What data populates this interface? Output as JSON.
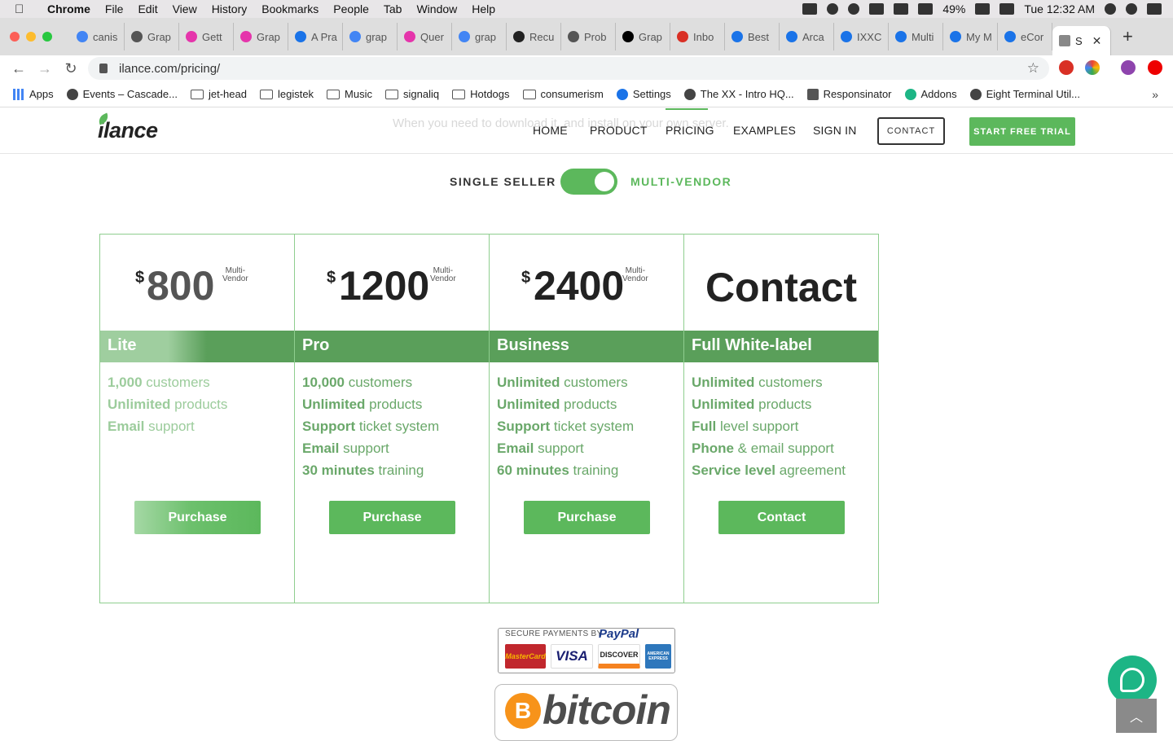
{
  "menubar": {
    "app": "Chrome",
    "items": [
      "File",
      "Edit",
      "View",
      "History",
      "Bookmarks",
      "People",
      "Tab",
      "Window",
      "Help"
    ],
    "battery": "49%",
    "clock": "Tue 12:32 AM"
  },
  "tabs": [
    {
      "label": "canis",
      "color": "#4285f4"
    },
    {
      "label": "Grap",
      "color": "#555555"
    },
    {
      "label": "Gett",
      "color": "#e535ab"
    },
    {
      "label": "Grap",
      "color": "#e535ab"
    },
    {
      "label": "A Pra",
      "color": "#1a73e8"
    },
    {
      "label": "grap",
      "color": "#4285f4"
    },
    {
      "label": "Quer",
      "color": "#e535ab"
    },
    {
      "label": "grap",
      "color": "#4285f4"
    },
    {
      "label": "Recu",
      "color": "#222222"
    },
    {
      "label": "Prob",
      "color": "#555555"
    },
    {
      "label": "Grap",
      "color": "#000000"
    },
    {
      "label": "Inbo",
      "color": "#d93025"
    },
    {
      "label": "Best",
      "color": "#1a73e8"
    },
    {
      "label": "Arca",
      "color": "#1a73e8"
    },
    {
      "label": "IXXC",
      "color": "#1a73e8"
    },
    {
      "label": "Multi",
      "color": "#1a73e8"
    },
    {
      "label": "My M",
      "color": "#1a73e8"
    },
    {
      "label": "eCor",
      "color": "#1a73e8"
    }
  ],
  "active_tab": {
    "label": "S"
  },
  "address": {
    "url": "ilance.com/pricing/"
  },
  "bookmarks": [
    {
      "label": "Apps",
      "icon": "apps-grid-icon"
    },
    {
      "label": "Events – Cascade...",
      "icon": "site-icon"
    },
    {
      "label": "jet-head",
      "icon": "folder-icon"
    },
    {
      "label": "legistek",
      "icon": "folder-icon"
    },
    {
      "label": "Music",
      "icon": "folder-icon"
    },
    {
      "label": "signaliq",
      "icon": "folder-icon"
    },
    {
      "label": "Hotdogs",
      "icon": "folder-icon"
    },
    {
      "label": "consumerism",
      "icon": "folder-icon"
    },
    {
      "label": "Settings",
      "icon": "gear-icon"
    },
    {
      "label": "The XX - Intro HQ...",
      "icon": "film-icon"
    },
    {
      "label": "Responsinator",
      "icon": "r-icon"
    },
    {
      "label": "Addons",
      "icon": "puzzle-icon"
    },
    {
      "label": "Eight Terminal Util...",
      "icon": "globe-icon"
    }
  ],
  "site": {
    "logo": "ilance",
    "ghost_text": "When you need to download it, and install on your own server.",
    "nav": [
      "HOME",
      "PRODUCT",
      "PRICING",
      "EXAMPLES",
      "SIGN IN"
    ],
    "contact_button": "CONTACT",
    "trial_button": "START FREE TRIAL",
    "brand_color": "#5cb85c"
  },
  "toggle": {
    "left": "SINGLE SELLER",
    "right": "MULTI-VENDOR",
    "state": "multi-vendor"
  },
  "plans": [
    {
      "currency": "$",
      "price": "800",
      "suffix_1": "Multi-",
      "suffix_2": "Vendor",
      "name": "Lite",
      "features": [
        [
          "1,000",
          " customers"
        ],
        [
          "Unlimited",
          " products"
        ],
        [
          "Email",
          " support"
        ]
      ],
      "cta": "Purchase"
    },
    {
      "currency": "$",
      "price": "1200",
      "suffix_1": "Multi-",
      "suffix_2": "Vendor",
      "name": "Pro",
      "features": [
        [
          "10,000",
          " customers"
        ],
        [
          "Unlimited",
          " products"
        ],
        [
          "Support",
          " ticket system"
        ],
        [
          "Email",
          " support"
        ],
        [
          "30 minutes",
          " training"
        ]
      ],
      "cta": "Purchase"
    },
    {
      "currency": "$",
      "price": "2400",
      "suffix_1": "Multi-",
      "suffix_2": "Vendor",
      "name": "Business",
      "features": [
        [
          "Unlimited",
          " customers"
        ],
        [
          "Unlimited",
          " products"
        ],
        [
          "Support",
          " ticket system"
        ],
        [
          "Email",
          " support"
        ],
        [
          "60 minutes",
          " training"
        ]
      ],
      "cta": "Purchase"
    },
    {
      "price": "Contact",
      "name": "Full White-label",
      "features": [
        [
          "Unlimited",
          " customers"
        ],
        [
          "Unlimited",
          " products"
        ],
        [
          "Full",
          " level support"
        ],
        [
          "Phone",
          " & email support"
        ],
        [
          "Service level",
          " agreement"
        ]
      ],
      "cta": "Contact"
    }
  ],
  "payments": {
    "caption": "SECURE PAYMENTS BY",
    "paypal": "PayPal",
    "cards": [
      "MasterCard",
      "VISA",
      "DISCOVER",
      "AMERICAN EXPRESS"
    ],
    "bitcoin": "bitcoin",
    "bitcoin_symbol": "B"
  }
}
